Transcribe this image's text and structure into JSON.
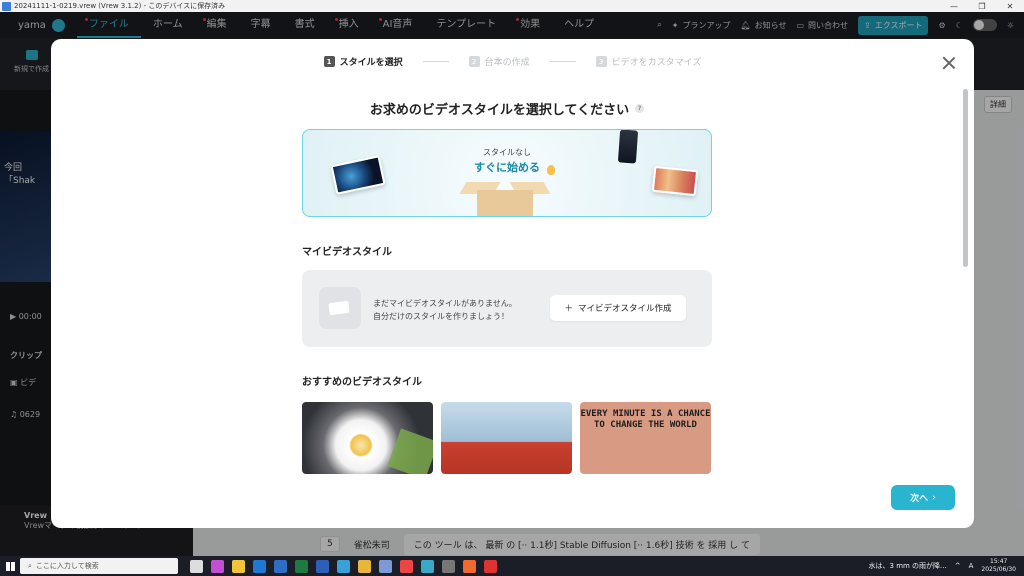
{
  "window": {
    "title": "20241111-1-0219.vrew (Vrew 3.1.2) - このデバイスに保存済み",
    "controls": [
      "—",
      "❐",
      "✕"
    ]
  },
  "menubar": {
    "user": "yama",
    "menus": [
      {
        "label": "ファイル",
        "active": true,
        "dot": true
      },
      {
        "label": "ホーム",
        "active": false,
        "dot": false
      },
      {
        "label": "編集",
        "active": false,
        "dot": true
      },
      {
        "label": "字幕",
        "active": false,
        "dot": false
      },
      {
        "label": "書式",
        "active": false,
        "dot": false
      },
      {
        "label": "挿入",
        "active": false,
        "dot": true
      },
      {
        "label": "AI音声",
        "active": false,
        "dot": true
      },
      {
        "label": "テンプレート",
        "active": false,
        "dot": false
      },
      {
        "label": "効果",
        "active": false,
        "dot": true
      },
      {
        "label": "ヘルプ",
        "active": false,
        "dot": false
      }
    ],
    "plan_up": "プランアップ",
    "notice": "お知らせ",
    "contact": "問い合わせ",
    "export": "エクスポート"
  },
  "background": {
    "new_create": "新規で作成",
    "preview_text_1": "今回",
    "preview_text_2": "「Shak",
    "time": "00:00",
    "clip_label": "クリップ",
    "video_label": "ビデ",
    "audio_label": "0629",
    "detail_button": "詳細",
    "row_number": "5",
    "speaker": "雀松朱司",
    "row_text": "この ツール は、 最新 の [·· 1.1秒] Stable Diffusion [·· 1.6秒] 技術 を 採用 し て",
    "notice_title": "Vrew",
    "notice_text": "Vrewマークの前脳がプレミアム..."
  },
  "modal": {
    "steps": [
      {
        "num": "1",
        "label": "スタイルを選択",
        "active": true
      },
      {
        "num": "2",
        "label": "台本の作成",
        "active": false
      },
      {
        "num": "3",
        "label": "ビデオをカスタマイズ",
        "active": false
      }
    ],
    "title": "お求めのビデオスタイルを選択してください",
    "help_icon": "?",
    "no_style": {
      "sub": "スタイルなし",
      "main": "すぐに始める"
    },
    "my_styles_title": "マイビデオスタイル",
    "my_styles_empty_line1": "まだマイビデオスタイルがありません。",
    "my_styles_empty_line2": "自分だけのスタイルを作りましょう！",
    "create_button": "マイビデオスタイル作成",
    "recommended_title": "おすすめのビデオスタイル",
    "thumb3_text": "EVERY MINUTE IS A CHANCE TO CHANGE THE WORLD",
    "next_button": "次へ"
  },
  "taskbar": {
    "search_placeholder": "ここに入力して検索",
    "weather": "水は、3 mm の雨が降...",
    "ime": "A",
    "time": "15:47",
    "date": "2025/06/30"
  }
}
